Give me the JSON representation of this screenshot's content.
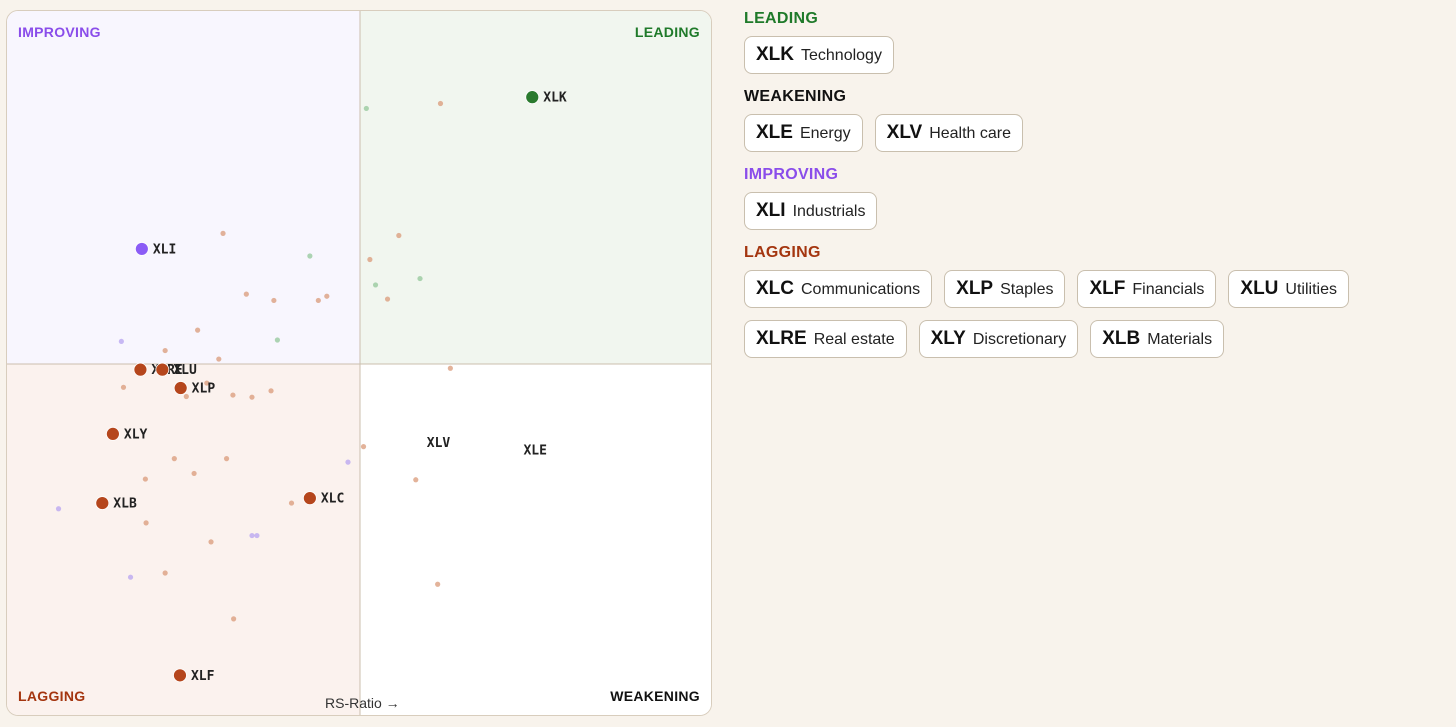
{
  "quadrants": {
    "improving": {
      "label": "IMPROVING",
      "color": "#8a4dea",
      "bg": "#f8f6fe"
    },
    "leading": {
      "label": "LEADING",
      "color": "#1f7a2a",
      "bg": "#f1f6ef"
    },
    "lagging": {
      "label": "LAGGING",
      "color": "#a4350f",
      "bg": "#fbf2ee"
    },
    "weakening": {
      "label": "WEAKENING",
      "color": "#111111",
      "bg": "#ffffff"
    }
  },
  "axis_x_label": "RS-Ratio →",
  "chart_data": {
    "type": "scatter",
    "title": "",
    "xlabel": "RS-Ratio",
    "ylabel": "",
    "xlim": [
      0,
      100
    ],
    "ylim": [
      0,
      100
    ],
    "center": [
      50,
      50
    ],
    "points": [
      {
        "symbol": "XLK",
        "x": 74.4,
        "y": 87.8,
        "quadrant": "leading"
      },
      {
        "symbol": "XLI",
        "x": 19.1,
        "y": 66.3,
        "quadrant": "improving"
      },
      {
        "symbol": "XLRE",
        "x": 18.9,
        "y": 49.2,
        "quadrant": "lagging"
      },
      {
        "symbol": "XLU",
        "x": 22.0,
        "y": 49.2,
        "quadrant": "lagging"
      },
      {
        "symbol": "XLP",
        "x": 24.6,
        "y": 46.6,
        "quadrant": "lagging"
      },
      {
        "symbol": "XLY",
        "x": 15.0,
        "y": 40.1,
        "quadrant": "lagging"
      },
      {
        "symbol": "XLB",
        "x": 13.5,
        "y": 30.3,
        "quadrant": "lagging"
      },
      {
        "symbol": "XLC",
        "x": 42.9,
        "y": 31.0,
        "quadrant": "lagging"
      },
      {
        "symbol": "XLF",
        "x": 24.5,
        "y": 5.9,
        "quadrant": "lagging"
      },
      {
        "symbol": "XLV",
        "x": 57.9,
        "y": 38.9,
        "quadrant": "weakening"
      },
      {
        "symbol": "XLE",
        "x": 71.6,
        "y": 37.8,
        "quadrant": "weakening"
      }
    ],
    "trail_points": [
      {
        "x": 50.9,
        "y": 86.2,
        "q": "leading"
      },
      {
        "x": 61.4,
        "y": 86.9,
        "q": "lagging"
      },
      {
        "x": 30.6,
        "y": 68.5,
        "q": "lagging"
      },
      {
        "x": 42.9,
        "y": 65.3,
        "q": "leading"
      },
      {
        "x": 55.5,
        "y": 68.2,
        "q": "lagging"
      },
      {
        "x": 51.4,
        "y": 64.8,
        "q": "lagging"
      },
      {
        "x": 58.5,
        "y": 62.1,
        "q": "leading"
      },
      {
        "x": 52.2,
        "y": 61.2,
        "q": "leading"
      },
      {
        "x": 33.9,
        "y": 59.9,
        "q": "lagging"
      },
      {
        "x": 37.8,
        "y": 59.0,
        "q": "lagging"
      },
      {
        "x": 44.1,
        "y": 59.0,
        "q": "lagging"
      },
      {
        "x": 45.3,
        "y": 59.6,
        "q": "lagging"
      },
      {
        "x": 53.9,
        "y": 59.2,
        "q": "lagging"
      },
      {
        "x": 27.0,
        "y": 54.8,
        "q": "lagging"
      },
      {
        "x": 16.2,
        "y": 53.2,
        "q": "improving"
      },
      {
        "x": 38.3,
        "y": 53.4,
        "q": "leading"
      },
      {
        "x": 22.4,
        "y": 51.9,
        "q": "lagging"
      },
      {
        "x": 30.0,
        "y": 50.7,
        "q": "lagging"
      },
      {
        "x": 62.8,
        "y": 49.4,
        "q": "lagging"
      },
      {
        "x": 16.5,
        "y": 46.7,
        "q": "lagging"
      },
      {
        "x": 28.3,
        "y": 47.3,
        "q": "lagging"
      },
      {
        "x": 32.0,
        "y": 45.6,
        "q": "lagging"
      },
      {
        "x": 34.7,
        "y": 45.3,
        "q": "lagging"
      },
      {
        "x": 37.4,
        "y": 46.2,
        "q": "lagging"
      },
      {
        "x": 25.4,
        "y": 45.4,
        "q": "lagging"
      },
      {
        "x": 50.5,
        "y": 38.3,
        "q": "lagging"
      },
      {
        "x": 23.7,
        "y": 36.6,
        "q": "lagging"
      },
      {
        "x": 31.1,
        "y": 36.6,
        "q": "lagging"
      },
      {
        "x": 48.3,
        "y": 36.1,
        "q": "improving"
      },
      {
        "x": 26.5,
        "y": 34.5,
        "q": "lagging"
      },
      {
        "x": 19.6,
        "y": 33.7,
        "q": "lagging"
      },
      {
        "x": 57.9,
        "y": 33.6,
        "q": "lagging"
      },
      {
        "x": 40.3,
        "y": 30.3,
        "q": "lagging"
      },
      {
        "x": 7.3,
        "y": 29.5,
        "q": "improving"
      },
      {
        "x": 19.7,
        "y": 27.5,
        "q": "lagging"
      },
      {
        "x": 34.7,
        "y": 25.7,
        "q": "improving"
      },
      {
        "x": 35.4,
        "y": 25.7,
        "q": "improving"
      },
      {
        "x": 28.9,
        "y": 24.8,
        "q": "lagging"
      },
      {
        "x": 17.5,
        "y": 19.8,
        "q": "improving"
      },
      {
        "x": 22.4,
        "y": 20.4,
        "q": "lagging"
      },
      {
        "x": 61.0,
        "y": 18.8,
        "q": "lagging"
      },
      {
        "x": 32.1,
        "y": 13.9,
        "q": "lagging"
      }
    ]
  },
  "panel": {
    "groups": [
      {
        "title": "LEADING",
        "color": "#1f7a2a",
        "items": [
          {
            "symbol": "XLK",
            "name": "Technology"
          }
        ]
      },
      {
        "title": "WEAKENING",
        "color": "#111111",
        "items": [
          {
            "symbol": "XLE",
            "name": "Energy"
          },
          {
            "symbol": "XLV",
            "name": "Health care"
          }
        ]
      },
      {
        "title": "IMPROVING",
        "color": "#8a4dea",
        "items": [
          {
            "symbol": "XLI",
            "name": "Industrials"
          }
        ]
      },
      {
        "title": "LAGGING",
        "color": "#a4350f",
        "items": [
          {
            "symbol": "XLC",
            "name": "Communications"
          },
          {
            "symbol": "XLP",
            "name": "Staples"
          },
          {
            "symbol": "XLF",
            "name": "Financials"
          },
          {
            "symbol": "XLU",
            "name": "Utilities"
          },
          {
            "symbol": "XLRE",
            "name": "Real estate"
          },
          {
            "symbol": "XLY",
            "name": "Discretionary"
          },
          {
            "symbol": "XLB",
            "name": "Materials"
          }
        ]
      }
    ]
  },
  "colors": {
    "lagging_dot": "#b5461c",
    "leading_dot": "#2a7a2e",
    "improving_dot": "#8b5cf6",
    "trail_lagging": "#d99a78",
    "trail_leading": "#93c79a",
    "trail_improving": "#b7a3f0"
  }
}
